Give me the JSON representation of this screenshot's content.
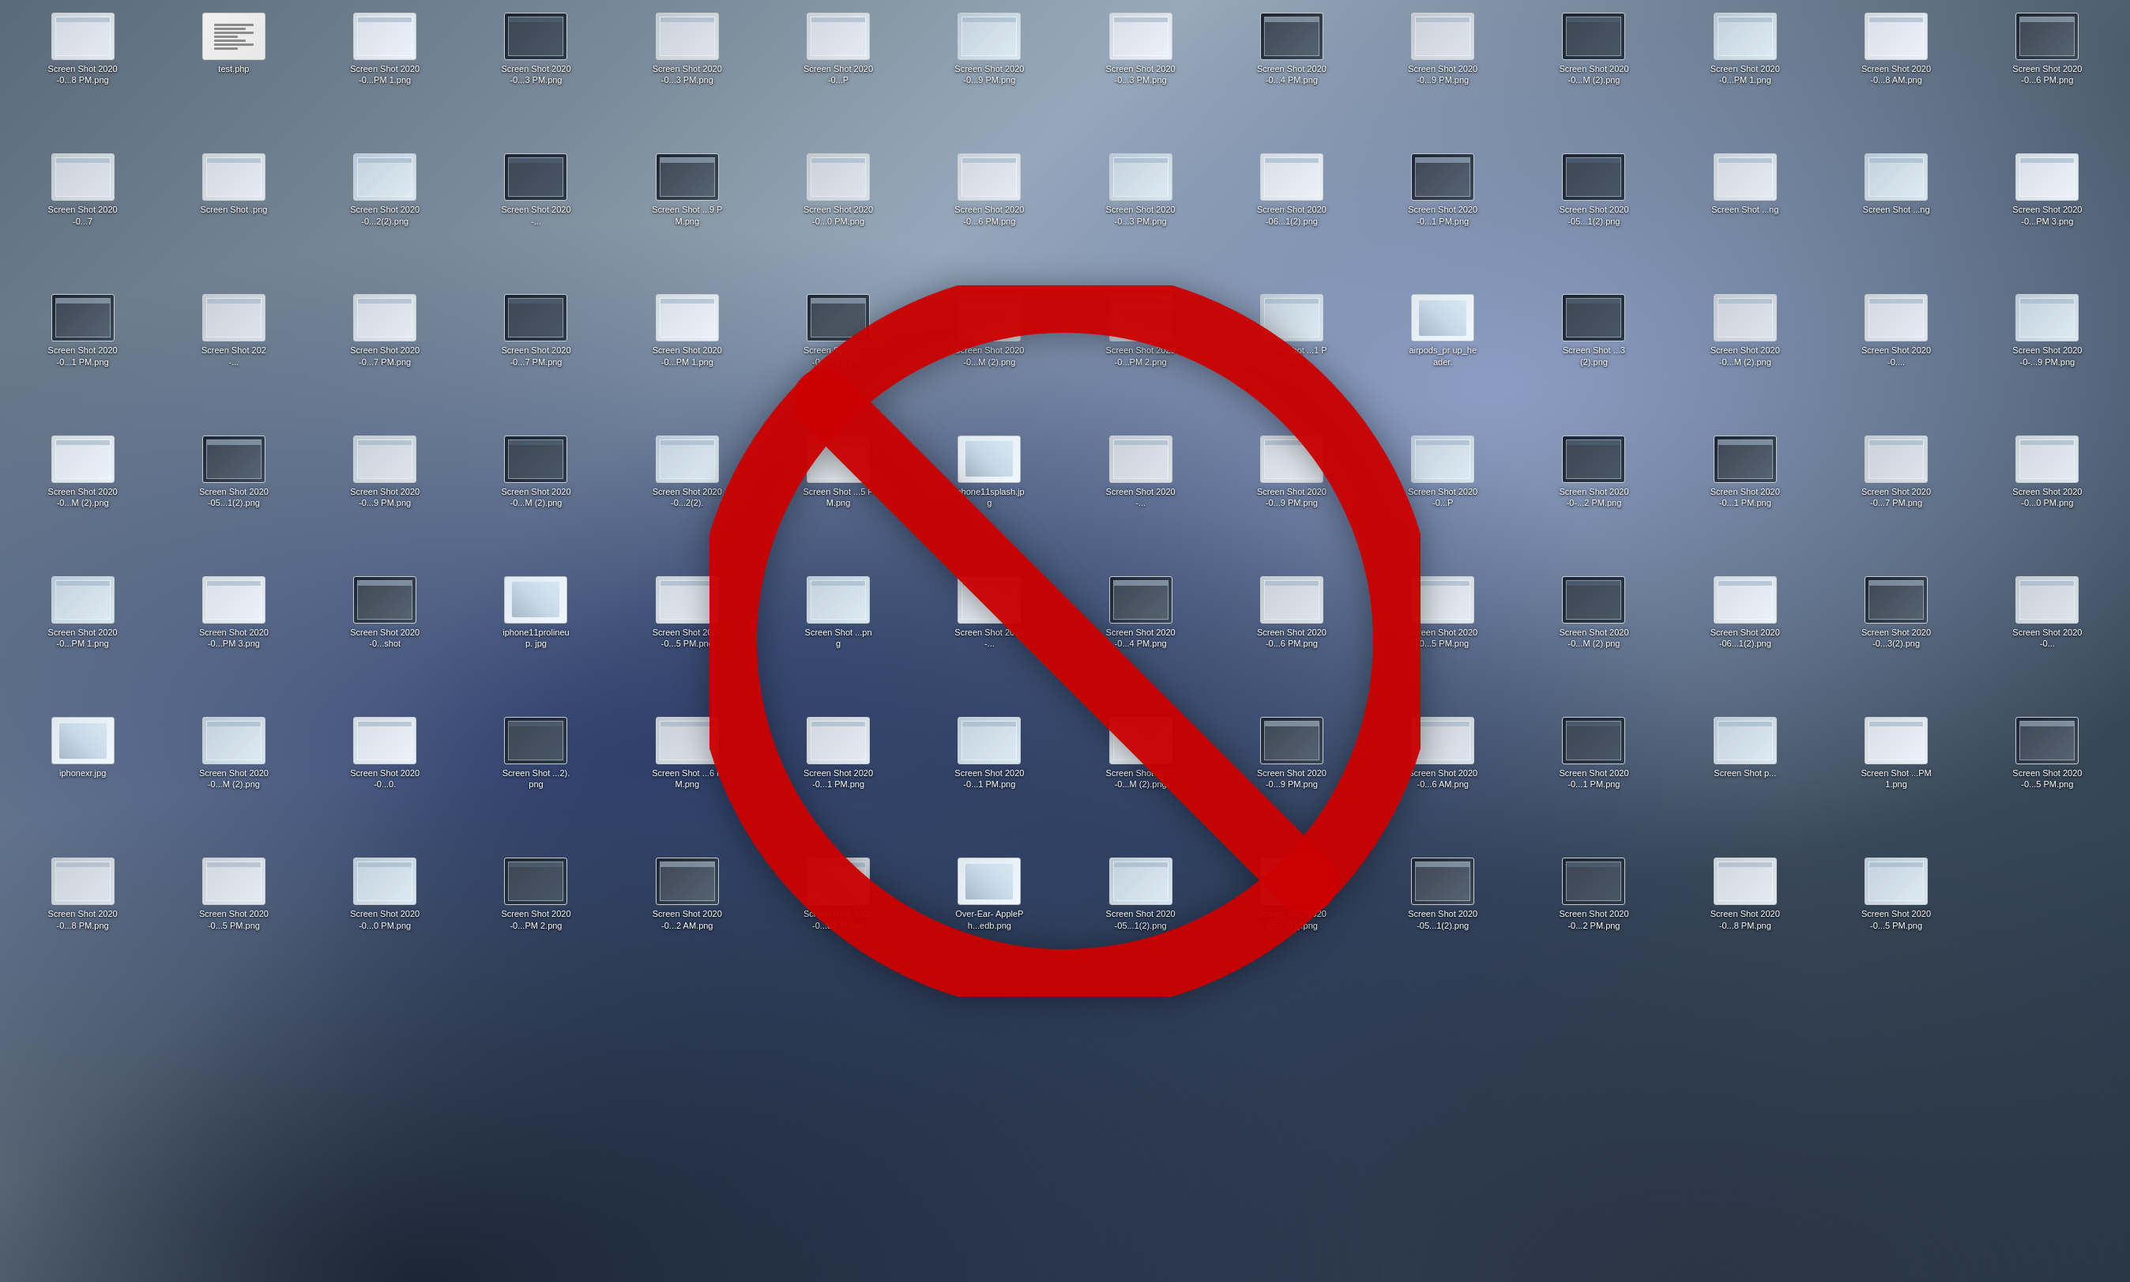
{
  "desktop": {
    "background": "macOS Catalina mountain wallpaper",
    "title": "macOS Desktop with many screenshot files"
  },
  "no_symbol": {
    "label": "No / Prohibited symbol",
    "color": "#cc0000",
    "stroke_color": "#ee0000",
    "circle_color": "#cc0000"
  },
  "icons": [
    {
      "name": "Screen Shot",
      "label": "Screen Shot\n2020-0...8 PM.png",
      "type": "screenshot"
    },
    {
      "name": "test.php",
      "label": "test.php",
      "type": "php"
    },
    {
      "name": "Screen Shot",
      "label": "Screen Shot\n2020-0...PM 1.png",
      "type": "screenshot"
    },
    {
      "name": "Screen Shot",
      "label": "Screen Shot\n2020-0...3 PM.png",
      "type": "screenshot"
    },
    {
      "name": "Screen Shot",
      "label": "Screen Shot\n2020-0...3 PM.png",
      "type": "screenshot"
    },
    {
      "name": "Screen Shot",
      "label": "Screen Shot\n2020-0...P",
      "type": "screenshot"
    },
    {
      "name": "Screen Shot",
      "label": "Screen Shot\n2020-0...9 PM.png",
      "type": "screenshot"
    },
    {
      "name": "Screen Shot",
      "label": "Screen Shot\n2020-0...3 PM.png",
      "type": "screenshot"
    },
    {
      "name": "Screen Shot",
      "label": "Screen Shot\n2020-0...4 PM.png",
      "type": "screenshot"
    },
    {
      "name": "Screen Shot",
      "label": "Screen Shot\n2020-0...9 PM.png",
      "type": "screenshot"
    },
    {
      "name": "Screen Shot",
      "label": "Screen Shot\n2020-0...M (2).png",
      "type": "screenshot"
    },
    {
      "name": "Screen Shot",
      "label": "Screen Shot\n2020-0...PM 1.png",
      "type": "screenshot"
    },
    {
      "name": "Screen Shot",
      "label": "Screen Shot\n2020-0...8 AM.png",
      "type": "screenshot"
    },
    {
      "name": "Screen Shot",
      "label": "Screen Shot\n2020-0...6 PM.png",
      "type": "screenshot"
    },
    {
      "name": "Screen Shot",
      "label": "Screen Shot\n2020-0...7",
      "type": "screenshot"
    },
    {
      "name": "Screen Shot",
      "label": "Screen Shot\n.png",
      "type": "screenshot"
    },
    {
      "name": "Screen Shot",
      "label": "Screen Shot\n2020-0...2(2).png",
      "type": "screenshot"
    },
    {
      "name": "Screen Shot",
      "label": "Screen Shot\n2020-...",
      "type": "screenshot"
    },
    {
      "name": "Screen Shot",
      "label": "Screen Shot\n...9 PM.png",
      "type": "screenshot"
    },
    {
      "name": "Screen Shot",
      "label": "Screen Shot\n2020-0...0 PM.png",
      "type": "screenshot"
    },
    {
      "name": "Screen Shot",
      "label": "Screen Shot\n2020-0...6 PM.png",
      "type": "screenshot"
    },
    {
      "name": "Screen Shot",
      "label": "Screen Shot\n2020-0...3 PM.png",
      "type": "screenshot"
    },
    {
      "name": "Screen Shot",
      "label": "Screen Shot\n2020-06...1(2).png",
      "type": "screenshot"
    },
    {
      "name": "Screen Shot",
      "label": "Screen Shot\n2020-0...1 PM.png",
      "type": "screenshot"
    },
    {
      "name": "Screen Shot",
      "label": "Screen Shot\n2020-05...1(2).png",
      "type": "screenshot"
    },
    {
      "name": "Screen Shot",
      "label": "Screen Shot\n...ng",
      "type": "screenshot"
    },
    {
      "name": "Screen Shot",
      "label": "Screen Shot\n...ng",
      "type": "screenshot"
    },
    {
      "name": "Screen Shot",
      "label": "Screen Shot\n2020-0...PM 3.png",
      "type": "screenshot"
    },
    {
      "name": "Screen Shot",
      "label": "Screen Shot\n2020-0...1 PM.png",
      "type": "screenshot"
    },
    {
      "name": "Screen Shot",
      "label": "Screen Shot\n202-...",
      "type": "screenshot"
    },
    {
      "name": "Screen Shot",
      "label": "Screen Shot\n2020-0...7 PM.png",
      "type": "screenshot"
    },
    {
      "name": "Screen Shot",
      "label": "Screen Shot\n2020-0...7 PM.png",
      "type": "screenshot"
    },
    {
      "name": "Screen Shot",
      "label": "Screen Shot\n2020-0...PM 1.png",
      "type": "screenshot"
    },
    {
      "name": "Screen Shot",
      "label": "Screen Shot\n2020-0...M (2).png",
      "type": "screenshot"
    },
    {
      "name": "Screen Shot",
      "label": "Screen Shot\n2020-0...M (2).png",
      "type": "screenshot"
    },
    {
      "name": "Screen Shot",
      "label": "Screen Shot\n2020-0...PM 2.png",
      "type": "screenshot"
    },
    {
      "name": "Screen Shot",
      "label": "Screen Shot\n...1 PM.png",
      "type": "screenshot"
    },
    {
      "name": "airpods_pr",
      "label": "airpods_pr\nup_header.",
      "type": "iphone"
    },
    {
      "name": "Screen Shot",
      "label": "Screen Shot\n...3(2).png",
      "type": "screenshot"
    },
    {
      "name": "Screen Shot",
      "label": "Screen Shot\n2020-0...M (2).png",
      "type": "screenshot"
    },
    {
      "name": "Screen Shot",
      "label": "Screen Shot\n2020-0....",
      "type": "screenshot"
    },
    {
      "name": "Screen Shot",
      "label": "Screen Shot\n2020-0-...9 PM.png",
      "type": "screenshot"
    },
    {
      "name": "Screen Shot",
      "label": "Screen Shot\n2020-0...M (2).png",
      "type": "screenshot"
    },
    {
      "name": "Screen Shot",
      "label": "Screen Shot\n2020-05...1(2).png",
      "type": "screenshot"
    },
    {
      "name": "Screen Shot",
      "label": "Screen Shot\n2020-0...9 PM.png",
      "type": "screenshot"
    },
    {
      "name": "Screen Shot",
      "label": "Screen Shot\n2020-0...M (2).png",
      "type": "screenshot"
    },
    {
      "name": "Screen Shot",
      "label": "Screen Shot\n2020-0...2(2).",
      "type": "screenshot"
    },
    {
      "name": "Screen Shot",
      "label": "Screen Shot\n...5 PM.png",
      "type": "screenshot"
    },
    {
      "name": "iphone11splash",
      "label": "iphone11splash.jp\ng",
      "type": "iphone"
    },
    {
      "name": "Screen Shot",
      "label": "Screen Shot\n2020-...",
      "type": "screenshot"
    },
    {
      "name": "Screen Shot",
      "label": "Screen Shot\n2020-0...9 PM.png",
      "type": "screenshot"
    },
    {
      "name": "Screen Shot",
      "label": "Screen Shot\n2020-0...P",
      "type": "screenshot"
    },
    {
      "name": "Screen Shot",
      "label": "Screen Shot\n2020-0-...2 PM.png",
      "type": "screenshot"
    },
    {
      "name": "Screen Shot",
      "label": "Screen Shot\n2020-0...1 PM.png",
      "type": "screenshot"
    },
    {
      "name": "Screen Shot",
      "label": "Screen Shot\n2020-0...7 PM.png",
      "type": "screenshot"
    },
    {
      "name": "Screen Shot",
      "label": "Screen Shot\n2020-0...0 PM.png",
      "type": "screenshot"
    },
    {
      "name": "Screen Shot",
      "label": "Screen Shot\n2020-0...PM 1.png",
      "type": "screenshot"
    },
    {
      "name": "Screen Shot",
      "label": "Screen Shot\n2020-0...PM 3.png",
      "type": "screenshot"
    },
    {
      "name": "Screen Shot",
      "label": "Screen Shot\n2020-0...shot",
      "type": "screenshot"
    },
    {
      "name": "iphone11prolineup",
      "label": "iphone11prolineup.\njpg",
      "type": "iphone"
    },
    {
      "name": "Screen Shot",
      "label": "Screen Shot\n2020-0...5 PM.png",
      "type": "screenshot"
    },
    {
      "name": "Screen Shot",
      "label": "Screen Shot\n...png",
      "type": "screenshot"
    },
    {
      "name": "Screen Shot",
      "label": "Screen Shot\n2020-...",
      "type": "screenshot"
    },
    {
      "name": "Screen Shot",
      "label": "Screen Shot\n2020-0...4 PM.png",
      "type": "screenshot"
    },
    {
      "name": "Screen Shot",
      "label": "Screen Shot\n2020-0...6 PM.png",
      "type": "screenshot"
    },
    {
      "name": "Screen Shot",
      "label": "Screen Shot\n2020-0...5 PM.png",
      "type": "screenshot"
    },
    {
      "name": "Screen Shot",
      "label": "Screen Shot\n2020-0...M (2).png",
      "type": "screenshot"
    },
    {
      "name": "Screen Shot",
      "label": "Screen Shot\n2020-06...1(2).png",
      "type": "screenshot"
    },
    {
      "name": "Screen Shot",
      "label": "Screen Shot\n2020-0...3(2).png",
      "type": "screenshot"
    },
    {
      "name": "Screen Shot",
      "label": "Screen Shot\n2020-0...",
      "type": "screenshot"
    },
    {
      "name": "iphonexr",
      "label": "iphonexr.jpg",
      "type": "iphone"
    },
    {
      "name": "Screen Shot",
      "label": "Screen Shot\n2020-0...M (2).png",
      "type": "screenshot"
    },
    {
      "name": "Screen Shot",
      "label": "Screen Shot\n2020-0...0.",
      "type": "screenshot"
    },
    {
      "name": "Screen Shot",
      "label": "Screen Shot\n...2).png",
      "type": "screenshot"
    },
    {
      "name": "Screen Shot",
      "label": "Screen Shot\n...6 PM.png",
      "type": "screenshot"
    },
    {
      "name": "Screen Shot",
      "label": "Screen Shot\n2020-0...1 PM.png",
      "type": "screenshot"
    },
    {
      "name": "Screen Shot",
      "label": "Screen Shot\n2020-0...1 PM.png",
      "type": "screenshot"
    },
    {
      "name": "Screen Shot",
      "label": "Screen Shot\n2020-0...M (2).png",
      "type": "screenshot"
    },
    {
      "name": "Screen Shot",
      "label": "Screen Shot\n2020-0...9 PM.png",
      "type": "screenshot"
    },
    {
      "name": "Screen Shot",
      "label": "Screen Shot\n2020-0...6 AM.png",
      "type": "screenshot"
    },
    {
      "name": "Screen Shot",
      "label": "Screen Shot\n2020-0...1 PM.png",
      "type": "screenshot"
    },
    {
      "name": "Screen Shot",
      "label": "Screen Shot\np...",
      "type": "screenshot"
    },
    {
      "name": "Screen Shot",
      "label": "Screen Shot\n...PM 1.png",
      "type": "screenshot"
    },
    {
      "name": "Screen Shot",
      "label": "Screen Shot\n2020-0...5 PM.png",
      "type": "screenshot"
    },
    {
      "name": "Screen Shot",
      "label": "Screen Shot\n2020-0...8 PM.png",
      "type": "screenshot"
    },
    {
      "name": "Screen Shot",
      "label": "Screen Shot\n2020-0...5 PM.png",
      "type": "screenshot"
    },
    {
      "name": "Screen Shot",
      "label": "Screen Shot\n2020-0...0 PM.png",
      "type": "screenshot"
    },
    {
      "name": "Screen Shot",
      "label": "Screen Shot\n2020-0...PM 2.png",
      "type": "screenshot"
    },
    {
      "name": "Screen Shot",
      "label": "Screen Shot\n2020-0...2 AM.png",
      "type": "screenshot"
    },
    {
      "name": "Screen Shot",
      "label": "Screen Shot\n2020-0...3 PM.png",
      "type": "screenshot"
    },
    {
      "name": "Over-Ear",
      "label": "Over-Ear-\nApplePh...edb.png",
      "type": "iphone"
    },
    {
      "name": "Screen Shot",
      "label": "Screen Shot\n2020-05...1(2).png",
      "type": "screenshot"
    },
    {
      "name": "Screen Shot",
      "label": "Screen Shot\n2020-05...1(2).png",
      "type": "screenshot"
    },
    {
      "name": "Screen Shot",
      "label": "Screen Shot\n2020-05...1(2).png",
      "type": "screenshot"
    },
    {
      "name": "Screen Shot",
      "label": "Screen Shot\n2020-0...2 PM.png",
      "type": "screenshot"
    },
    {
      "name": "Screen Shot",
      "label": "Screen Shot\n2020-0...8 PM.png",
      "type": "screenshot"
    },
    {
      "name": "Screen Shot",
      "label": "Screen Shot\n2020-0...5 PM.png",
      "type": "screenshot"
    }
  ]
}
